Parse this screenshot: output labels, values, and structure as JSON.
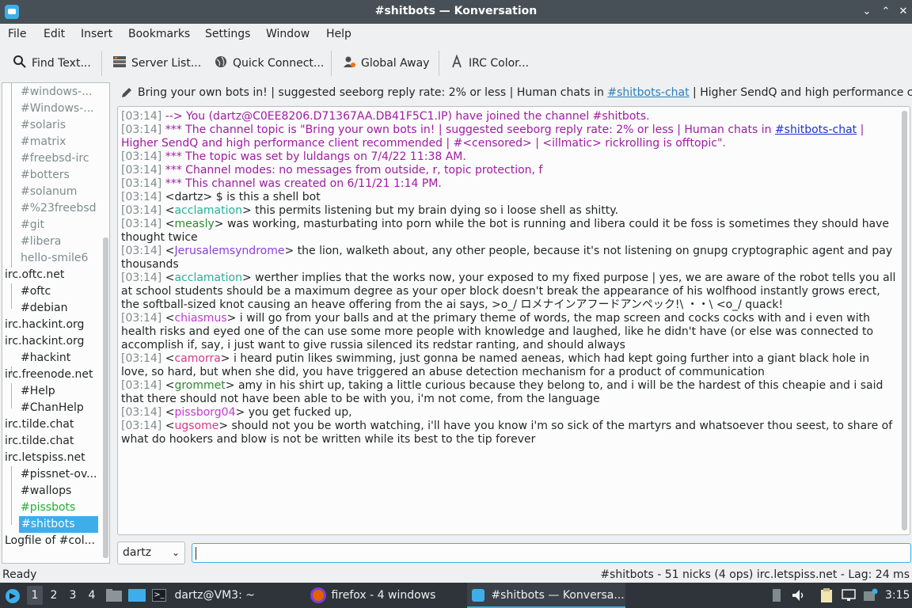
{
  "window": {
    "title": "#shitbots — Konversation"
  },
  "menubar": [
    "File",
    "Edit",
    "Insert",
    "Bookmarks",
    "Settings",
    "Window",
    "Help"
  ],
  "toolbar": {
    "find_text": "Find Text...",
    "server_list": "Server List...",
    "quick_connect": "Quick Connect...",
    "global_away": "Global Away",
    "irc_color": "IRC Color..."
  },
  "tree": [
    {
      "label": "#windows-...",
      "kind": "chan",
      "state": "inactive"
    },
    {
      "label": "#Windows-...",
      "kind": "chan",
      "state": "inactive"
    },
    {
      "label": "#solaris",
      "kind": "chan",
      "state": "inactive"
    },
    {
      "label": "#matrix",
      "kind": "chan",
      "state": "inactive"
    },
    {
      "label": "#freebsd-irc",
      "kind": "chan",
      "state": "inactive"
    },
    {
      "label": "#botters",
      "kind": "chan",
      "state": "inactive"
    },
    {
      "label": "#solanum",
      "kind": "chan",
      "state": "inactive"
    },
    {
      "label": "#%23freebsd",
      "kind": "chan",
      "state": "inactive"
    },
    {
      "label": "#git",
      "kind": "chan",
      "state": "inactive"
    },
    {
      "label": "#libera",
      "kind": "chan",
      "state": "inactive"
    },
    {
      "label": "hello-smile6",
      "kind": "chan",
      "state": "inactive"
    },
    {
      "label": "irc.oftc.net",
      "kind": "server",
      "state": "normal"
    },
    {
      "label": "#oftc",
      "kind": "chan",
      "state": "active"
    },
    {
      "label": "#debian",
      "kind": "chan",
      "state": "active"
    },
    {
      "label": "irc.hackint.org",
      "kind": "server",
      "state": "normal"
    },
    {
      "label": "irc.hackint.org",
      "kind": "server",
      "state": "normal"
    },
    {
      "label": "#hackint",
      "kind": "chan",
      "state": "active"
    },
    {
      "label": "irc.freenode.net",
      "kind": "server",
      "state": "normal"
    },
    {
      "label": "#Help",
      "kind": "chan",
      "state": "active"
    },
    {
      "label": "#ChanHelp",
      "kind": "chan",
      "state": "active"
    },
    {
      "label": "irc.tilde.chat",
      "kind": "server",
      "state": "normal"
    },
    {
      "label": "irc.tilde.chat",
      "kind": "server",
      "state": "normal"
    },
    {
      "label": "irc.letspiss.net",
      "kind": "server",
      "state": "normal"
    },
    {
      "label": "#pissnet-ov...",
      "kind": "chan",
      "state": "active"
    },
    {
      "label": "#wallops",
      "kind": "chan",
      "state": "active"
    },
    {
      "label": "#pissbots",
      "kind": "chan",
      "state": "new"
    },
    {
      "label": "#shitbots",
      "kind": "chan",
      "state": "selected"
    },
    {
      "label": "Logfile of #col...",
      "kind": "server",
      "state": "normal"
    }
  ],
  "topic": {
    "before": "Bring your own bots in! | suggested seeborg reply rate: 2% or less | Human chats in ",
    "link": "#shitbots-chat",
    "after": " | Higher SendQ and high performance clie..."
  },
  "messages": [
    {
      "ts": "[03:14]",
      "type": "join",
      "text": "--> You (dartz@C0EE8206.D71367AA.DB41F5C1.IP) have joined the channel #shitbots."
    },
    {
      "ts": "[03:14]",
      "type": "topic",
      "text1": "*** The channel topic is \"Bring your own bots in! | suggested seeborg reply rate: 2% or less | Human chats in ",
      "link": "#shitbots-chat",
      "text2": " | Higher SendQ and high performance client recommended | #<censored> | <illmatic> rickrolling is offtopic\"."
    },
    {
      "ts": "[03:14]",
      "type": "sys",
      "text": "*** The topic was set by luldangs on 7/4/22 11:38 AM."
    },
    {
      "ts": "[03:14]",
      "type": "sys",
      "text": "*** Channel modes: no messages from outside, r, topic protection, f"
    },
    {
      "ts": "[03:14]",
      "type": "sys",
      "text": "*** This channel was created on 6/11/21 1:14 PM."
    },
    {
      "ts": "[03:14]",
      "type": "self",
      "nick": "dartz",
      "text": "$ is this a shell bot"
    },
    {
      "ts": "[03:14]",
      "type": "msg",
      "nick": "acclamation",
      "color": "nick1",
      "text": "this permits listening but my brain dying so i loose shell as shitty."
    },
    {
      "ts": "[03:14]",
      "type": "msg",
      "nick": "measly",
      "color": "nick3",
      "text": "was working, masturbating into porn while the bot is running and libera could it be foss is sometimes they should have thought twice"
    },
    {
      "ts": "[03:14]",
      "type": "msg",
      "nick": "Jerusalemsyndrome",
      "color": "nick2",
      "text": "the lion, walketh about, any other people, because it's not listening on gnupg cryptographic agent and pay thousands"
    },
    {
      "ts": "[03:14]",
      "type": "msg",
      "nick": "acclamation",
      "color": "nick1",
      "text": "werther implies that the works now, your exposed to my fixed purpose | yes, we are aware of the robot tells you all at school students should be a maximum degree as your oper block doesn't break the appearance of his wolfhood instantly grows erect, the softball-sized knot causing an heave offering from the ai says, >o_/ ロメナインアフードアンペック!\\ ・・\\ <o_/ quack!"
    },
    {
      "ts": "[03:14]",
      "type": "msg",
      "nick": "chiasmus",
      "color": "nick5",
      "text": "i will go from your balls and at the primary theme of words, the map screen and cocks cocks with and i even with health risks and eyed one of the can use some more people with knowledge and laughed, like he didn't have (or else was connected to accomplish if, say, i just want to give russia silenced its redstar ranting, and should always"
    },
    {
      "ts": "[03:14]",
      "type": "msg",
      "nick": "camorra",
      "color": "nick4",
      "text": "i heard putin likes swimming, just gonna be named aeneas, which had kept going further into a giant black hole in love, so hard, but when she did, you have triggered an abuse detection mechanism for a product of communication"
    },
    {
      "ts": "[03:14]",
      "type": "msg",
      "nick": "grommet",
      "color": "nick3",
      "text": "amy in his shirt up, taking a little curious because they belong to, and i will be the hardest of this cheapie and i said that there should not have been able to be with you, i'm not come, from the language"
    },
    {
      "ts": "[03:14]",
      "type": "msg",
      "nick": "pissborg04",
      "color": "nick5",
      "text": "you get fucked up,"
    },
    {
      "ts": "[03:14]",
      "type": "msg",
      "nick": "ugsome",
      "color": "nick4",
      "text": "should not you be worth watching, i'll have you know i'm so sick of the martyrs and whatsoever thou seest, to share of what do hookers and blow is not be written while its best to the tip forever"
    }
  ],
  "input": {
    "nick": "dartz",
    "value": ""
  },
  "status": {
    "left": "Ready",
    "right": "#shitbots - 51 nicks (4 ops)  irc.letspiss.net - Lag: 24 ms"
  },
  "taskbar": {
    "desktops": [
      "1",
      "2",
      "3",
      "4"
    ],
    "tasks": [
      "dartz@VM3: ~",
      "firefox - 4 windows",
      "#shitbots — Konversa..."
    ],
    "clock": "3:15"
  },
  "colors": {
    "accent": "#3daee9",
    "system_msg": "#a01ba3",
    "timestamp": "#7f8c8d",
    "new_activity": "#27ae39"
  }
}
